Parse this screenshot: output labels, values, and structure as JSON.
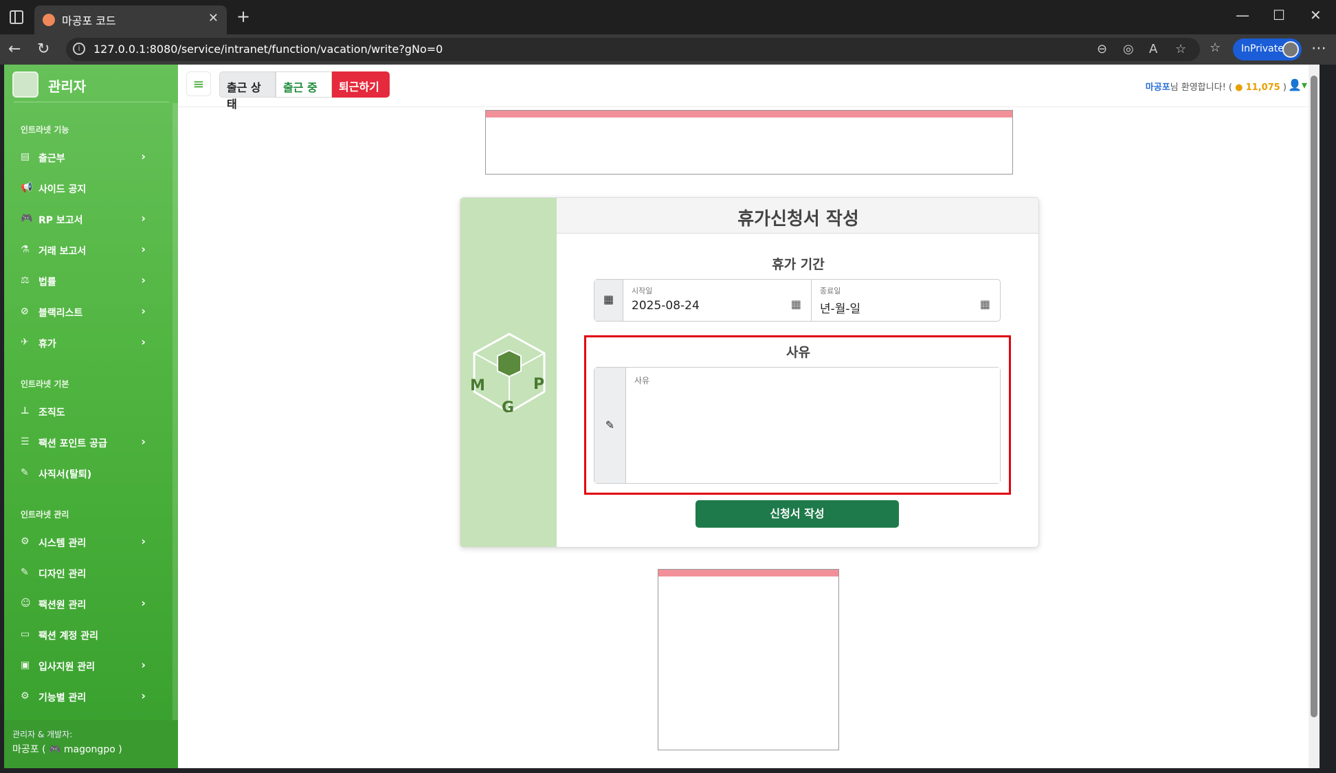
{
  "browser": {
    "tab_title": "마공포 코드",
    "tab_close": "✕",
    "new_tab": "+",
    "url": "127.0.0.1:8080/service/intranet/function/vacation/write?gNo=0",
    "inprivate_label": "InPrivate",
    "window_controls": {
      "minimize": "—",
      "maximize": "☐",
      "close": "✕"
    }
  },
  "sidebar": {
    "brand": "관리자",
    "sections": [
      {
        "title": "인트라넷 기능"
      },
      {
        "title": "인트라넷 기본"
      },
      {
        "title": "인트라넷 관리"
      }
    ],
    "items": [
      {
        "label": "출근부",
        "icon": "book-icon",
        "chevron": true
      },
      {
        "label": "사이드 공지",
        "icon": "megaphone-icon",
        "chevron": false
      },
      {
        "label": "RP 보고서",
        "icon": "gamepad-icon",
        "chevron": true
      },
      {
        "label": "거래 보고서",
        "icon": "flask-icon",
        "chevron": true
      },
      {
        "label": "법률",
        "icon": "scale-icon",
        "chevron": true
      },
      {
        "label": "블랙리스트",
        "icon": "ban-icon",
        "chevron": true
      },
      {
        "label": "휴가",
        "icon": "plane-icon",
        "chevron": true
      },
      {
        "label": "조직도",
        "icon": "sitemap-icon",
        "chevron": false
      },
      {
        "label": "팩션 포인트 공급",
        "icon": "coins-icon",
        "chevron": true
      },
      {
        "label": "사직서(탈퇴)",
        "icon": "pen-icon",
        "chevron": false
      },
      {
        "label": "시스템 관리",
        "icon": "gear-icon",
        "chevron": true
      },
      {
        "label": "디자인 관리",
        "icon": "brush-icon",
        "chevron": false
      },
      {
        "label": "팩션원 관리",
        "icon": "users-gear-icon",
        "chevron": true
      },
      {
        "label": "팩션 계정 관리",
        "icon": "id-card-icon",
        "chevron": false
      },
      {
        "label": "입사지원 관리",
        "icon": "briefcase-icon",
        "chevron": true
      },
      {
        "label": "기능별 관리",
        "icon": "gears-icon",
        "chevron": true
      }
    ],
    "footer_line1": "관리자 & 개발자:",
    "footer_line2": "마공포 ( 🎮 magongpo )"
  },
  "topbar": {
    "attendance_status": "출근 상태",
    "at_work": "출근 중",
    "leave_work": "퇴근하기",
    "welcome_name": "마공포",
    "welcome_text": "님 환영합니다! (",
    "points": "11,075",
    "welcome_end": ")"
  },
  "form": {
    "title": "휴가신청서 작성",
    "period_label": "휴가 기간",
    "start_label": "시작일",
    "start_value": "2025-08-24",
    "end_label": "종료일",
    "end_value": "년-월-일",
    "reason_label": "사유",
    "reason_placeholder": "사유",
    "submit": "신청서 작성"
  },
  "colors": {
    "sidebar_green": "#4fb43f",
    "submit_green": "#1e7a4a",
    "leave_red": "#e42a3c",
    "highlight_red": "#e00010",
    "ad_pink": "#f19099"
  }
}
